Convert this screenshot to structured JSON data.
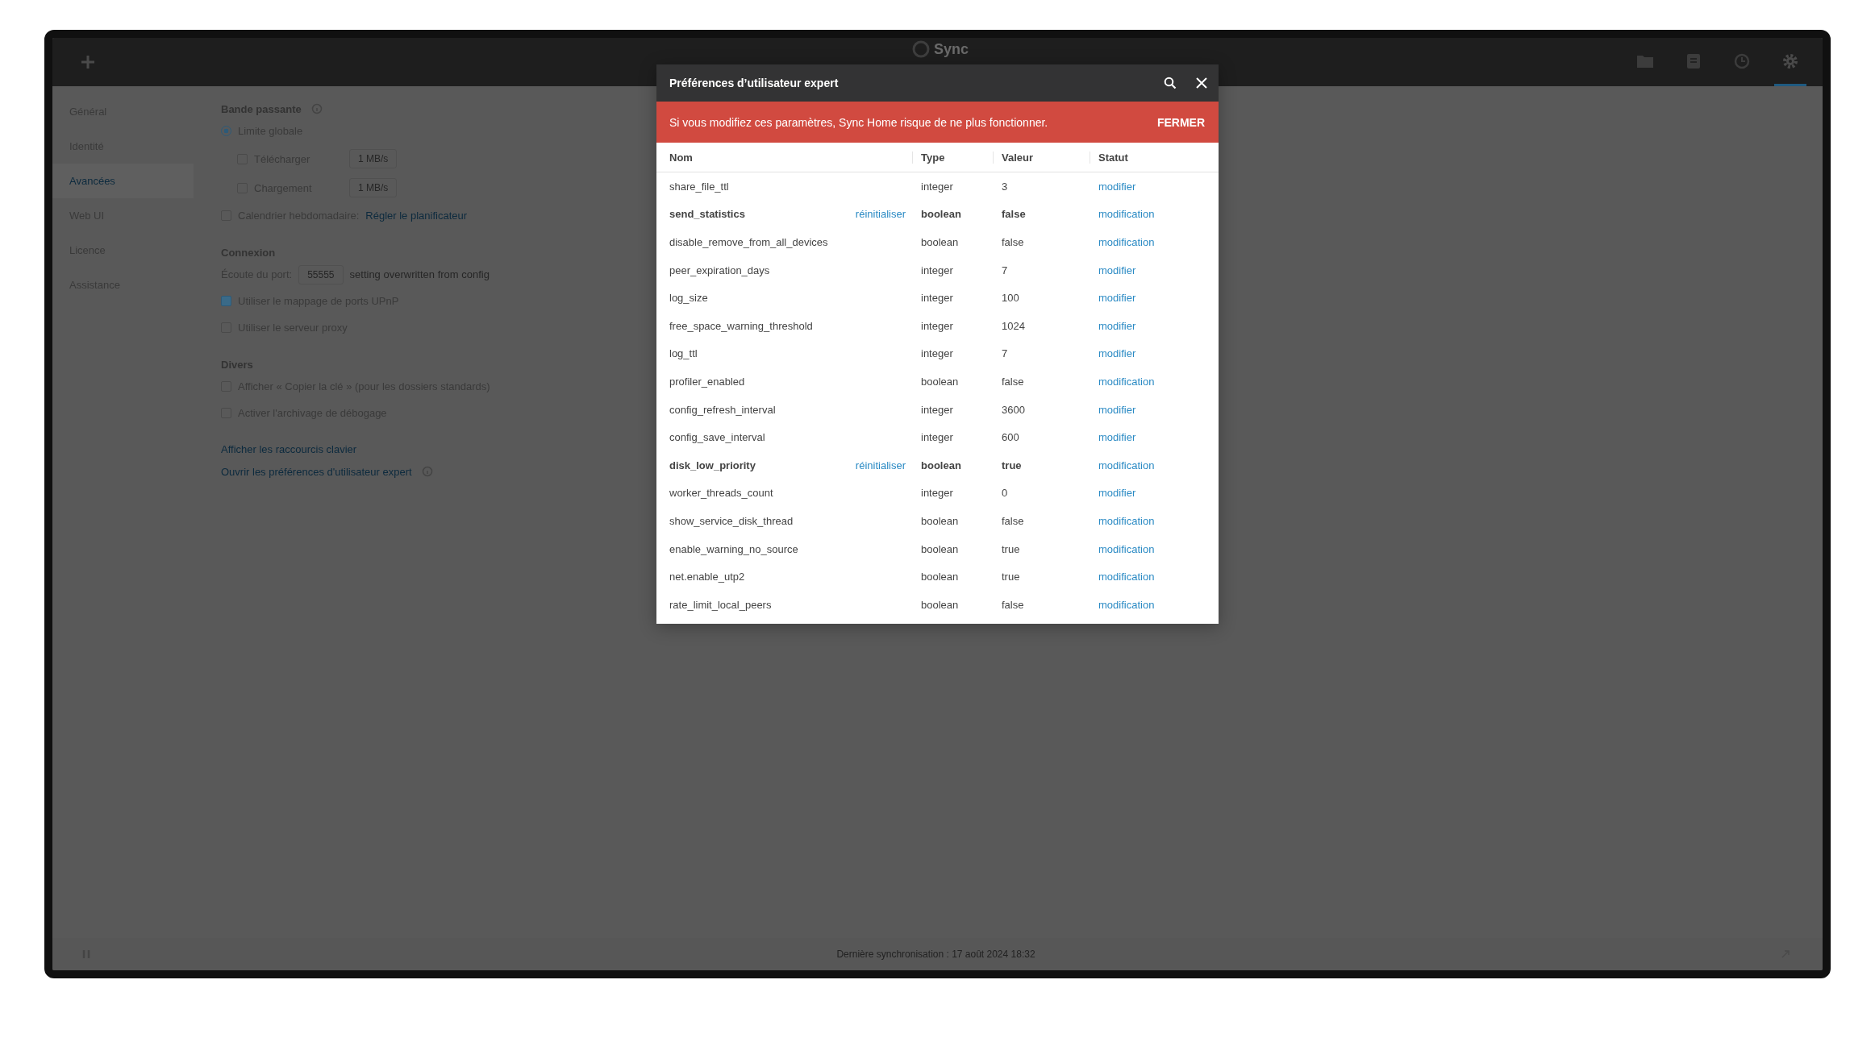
{
  "topbar": {
    "logo": "Sync",
    "nav_icons": [
      {
        "kind": "folder",
        "selected": false
      },
      {
        "kind": "document",
        "selected": false
      },
      {
        "kind": "clock",
        "selected": false
      },
      {
        "kind": "gear",
        "selected": true
      }
    ]
  },
  "sidebar": {
    "items": [
      {
        "label": "Général",
        "selected": false
      },
      {
        "label": "Identité",
        "selected": false
      },
      {
        "label": "Avancées",
        "selected": true
      },
      {
        "label": "Web UI",
        "selected": false
      },
      {
        "label": "Licence",
        "selected": false
      },
      {
        "label": "Assistance",
        "selected": false
      }
    ]
  },
  "bandwidth": {
    "title": "Bande passante",
    "global_limit": {
      "label": "Limite globale",
      "selected": true
    },
    "limits": [
      {
        "label": "Télécharger",
        "checked": false,
        "placeholder": "1 MB/s"
      },
      {
        "label": "Chargement",
        "checked": false,
        "placeholder": "1 MB/s"
      }
    ],
    "schedule": {
      "label": "Calendrier hebdomadaire:",
      "checked": false,
      "link": "Régler le planificateur"
    }
  },
  "connection": {
    "title": "Connexion",
    "port_label": "Écoute du port:",
    "port_value": "55555",
    "port_note": "setting overwritten from config",
    "options": [
      {
        "label": "Utiliser le mappage de ports UPnP",
        "checked": true
      },
      {
        "label": "Utiliser le serveur proxy",
        "checked": false
      }
    ]
  },
  "misc": {
    "title": "Divers",
    "options": [
      {
        "label": "Afficher « Copier la clé » (pour les dossiers standards)",
        "checked": false
      },
      {
        "label": "Activer l'archivage de débogage",
        "checked": false
      }
    ],
    "links": [
      {
        "label": "Afficher les raccourcis clavier",
        "kind": "plain"
      },
      {
        "label": "Ouvrir les préférences d'utilisateur expert",
        "kind": "with_info"
      }
    ]
  },
  "status_bar": {
    "text": "Dernière synchronisation : 17 août 2024 18:32"
  },
  "dialog": {
    "title": "Préférences d’utilisateur expert",
    "warning": {
      "text": "Si vous modifiez ces paramètres, Sync Home risque de ne plus fonctionner.",
      "action": "FERMER"
    },
    "columns": [
      "Nom",
      "Type",
      "Valeur",
      "Statut"
    ],
    "rows": [
      {
        "name": "share_file_ttl",
        "modified": false,
        "type": "integer",
        "value": "3",
        "status": "modifier"
      },
      {
        "name": "send_statistics",
        "modified": true,
        "reset": "réinitialiser",
        "type": "boolean",
        "value": "false",
        "status": "modification"
      },
      {
        "name": "disable_remove_from_all_devices",
        "modified": false,
        "type": "boolean",
        "value": "false",
        "status": "modification"
      },
      {
        "name": "peer_expiration_days",
        "modified": false,
        "type": "integer",
        "value": "7",
        "status": "modifier"
      },
      {
        "name": "log_size",
        "modified": false,
        "type": "integer",
        "value": "100",
        "status": "modifier"
      },
      {
        "name": "free_space_warning_threshold",
        "modified": false,
        "type": "integer",
        "value": "1024",
        "status": "modifier"
      },
      {
        "name": "log_ttl",
        "modified": false,
        "type": "integer",
        "value": "7",
        "status": "modifier"
      },
      {
        "name": "profiler_enabled",
        "modified": false,
        "type": "boolean",
        "value": "false",
        "status": "modification"
      },
      {
        "name": "config_refresh_interval",
        "modified": false,
        "type": "integer",
        "value": "3600",
        "status": "modifier"
      },
      {
        "name": "config_save_interval",
        "modified": false,
        "type": "integer",
        "value": "600",
        "status": "modifier"
      },
      {
        "name": "disk_low_priority",
        "modified": true,
        "reset": "réinitialiser",
        "type": "boolean",
        "value": "true",
        "status": "modification"
      },
      {
        "name": "worker_threads_count",
        "modified": false,
        "type": "integer",
        "value": "0",
        "status": "modifier"
      },
      {
        "name": "show_service_disk_thread",
        "modified": false,
        "type": "boolean",
        "value": "false",
        "status": "modification"
      },
      {
        "name": "enable_warning_no_source",
        "modified": false,
        "type": "boolean",
        "value": "true",
        "status": "modification"
      },
      {
        "name": "net.enable_utp2",
        "modified": false,
        "type": "boolean",
        "value": "true",
        "status": "modification"
      },
      {
        "name": "rate_limit_local_peers",
        "modified": false,
        "type": "boolean",
        "value": "false",
        "status": "modification"
      }
    ]
  }
}
